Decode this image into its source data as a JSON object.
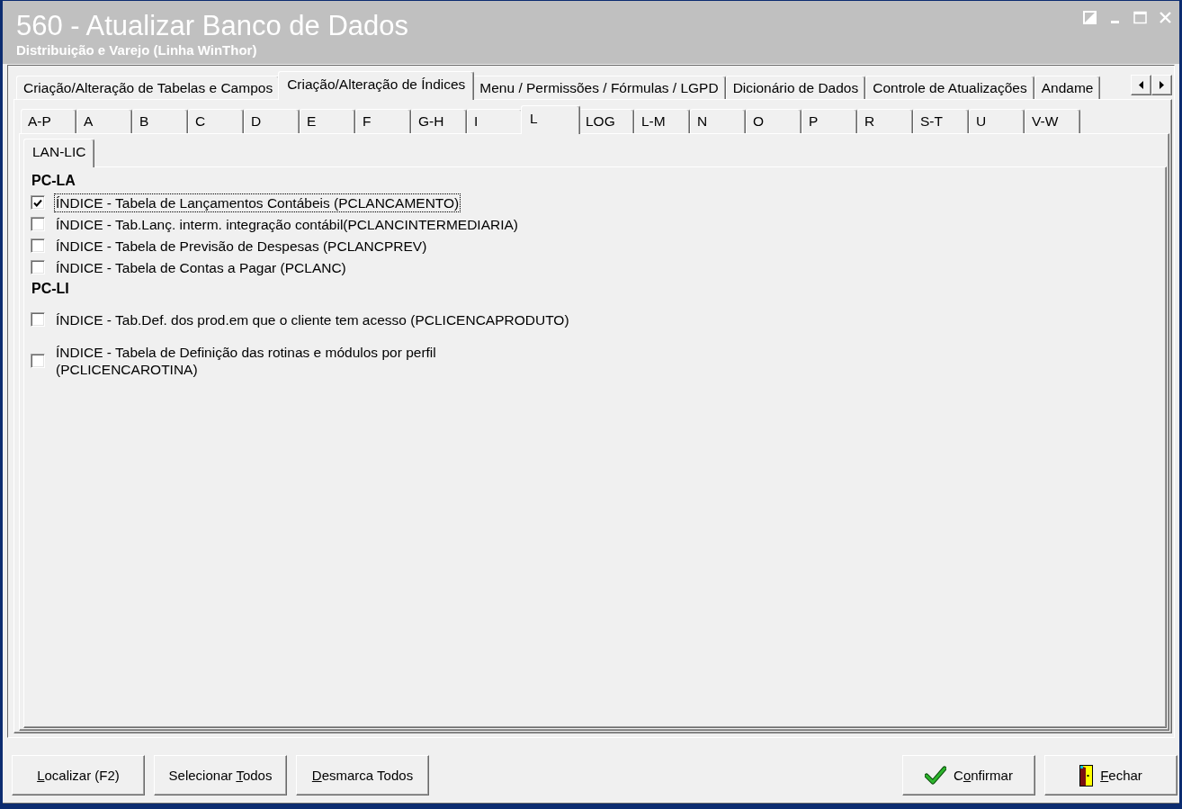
{
  "window": {
    "title": "560 - Atualizar Banco de Dados",
    "subtitle": "Distribuição e Varejo (Linha WinThor)"
  },
  "main_tabs": [
    {
      "label": "Criação/Alteração de Tabelas e Campos",
      "selected": false
    },
    {
      "label": "Criação/Alteração de Índices",
      "selected": true
    },
    {
      "label": "Menu / Permissões / Fórmulas / LGPD",
      "selected": false
    },
    {
      "label": "Dicionário de Dados",
      "selected": false
    },
    {
      "label": "Controle de Atualizações",
      "selected": false
    },
    {
      "label": "Andame",
      "selected": false
    }
  ],
  "letter_tabs": [
    {
      "label": "A-P",
      "selected": false
    },
    {
      "label": "A",
      "selected": false
    },
    {
      "label": "B",
      "selected": false
    },
    {
      "label": "C",
      "selected": false
    },
    {
      "label": "D",
      "selected": false
    },
    {
      "label": "E",
      "selected": false
    },
    {
      "label": "F",
      "selected": false
    },
    {
      "label": "G-H",
      "selected": false
    },
    {
      "label": "I",
      "selected": false
    },
    {
      "label": "L",
      "selected": true
    },
    {
      "label": "LOG",
      "selected": false
    },
    {
      "label": "L-M",
      "selected": false
    },
    {
      "label": "N",
      "selected": false
    },
    {
      "label": "O",
      "selected": false
    },
    {
      "label": "P",
      "selected": false
    },
    {
      "label": "R",
      "selected": false
    },
    {
      "label": "S-T",
      "selected": false
    },
    {
      "label": "U",
      "selected": false
    },
    {
      "label": "V-W",
      "selected": false
    }
  ],
  "sub_tabs": [
    {
      "label": "LAN-LIC",
      "selected": true
    }
  ],
  "groups": [
    {
      "title": "PC-LA",
      "items": [
        {
          "label": "ÍNDICE - Tabela de Lançamentos Contábeis (PCLANCAMENTO)",
          "checked": true,
          "focused": true,
          "kind": "compact"
        },
        {
          "label": "ÍNDICE - Tab.Lanç. interm. integração contábil(PCLANCINTERMEDIARIA)",
          "checked": false,
          "focused": false,
          "kind": "compact"
        },
        {
          "label": "ÍNDICE - Tabela de Previsão de Despesas (PCLANCPREV)",
          "checked": false,
          "focused": false,
          "kind": "compact"
        },
        {
          "label": "ÍNDICE - Tabela de Contas a Pagar (PCLANC)",
          "checked": false,
          "focused": false,
          "kind": "compact"
        }
      ]
    },
    {
      "title": "PC-LI",
      "items": [
        {
          "label": "ÍNDICE - Tab.Def. dos prod.em que o cliente tem acesso (PCLICENCAPRODUTO)",
          "checked": false,
          "focused": false,
          "kind": "tall"
        },
        {
          "label": "ÍNDICE - Tabela de Definição das rotinas e módulos por perfil (PCLICENCAROTINA)",
          "checked": false,
          "focused": false,
          "kind": "wrapped"
        }
      ]
    }
  ],
  "buttons_left": [
    {
      "key": "L",
      "rest": "ocalizar (F2)",
      "kind": "plain"
    },
    {
      "lead": "Selecionar ",
      "key": "T",
      "rest": "odos",
      "kind": "plain"
    },
    {
      "key": "D",
      "rest": "esmarca Todos",
      "kind": "plain"
    }
  ],
  "buttons_right": [
    {
      "lead": "C",
      "key": "o",
      "rest": "nfirmar",
      "kind": "confirm"
    },
    {
      "key": "F",
      "rest": "echar",
      "kind": "close"
    }
  ]
}
